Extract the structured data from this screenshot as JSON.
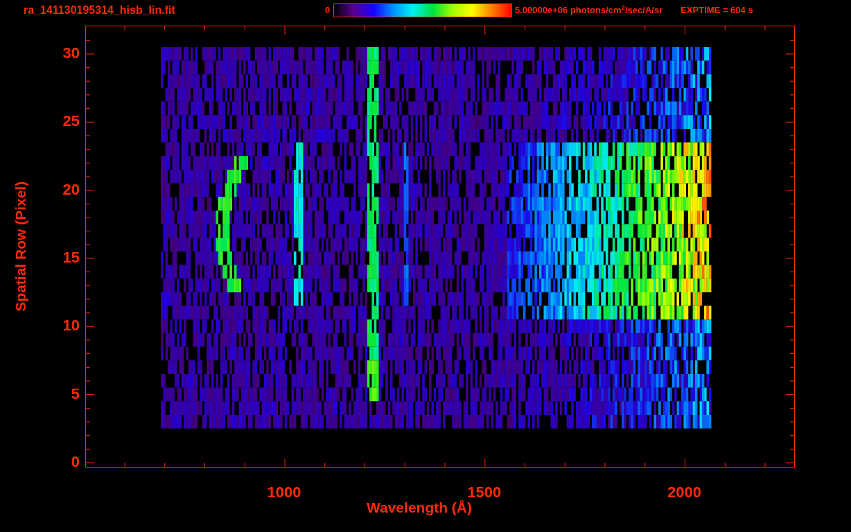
{
  "header": {
    "filename": "ra_141130195314_hisb_lin.fit",
    "colorbar_min": "0",
    "colorbar_max": "5.00000e+06 photons/cm$^{2}$/sec/A/sr",
    "exptime": "EXPTIME = 604 s"
  },
  "y_axis": {
    "title": "Spatial Row (Pixel)",
    "ticks": [
      "30",
      "25",
      "20",
      "15",
      "10",
      "5",
      "0"
    ]
  },
  "x_axis": {
    "title": "Wavelength (Å)",
    "ticks": [
      "1000",
      "1500",
      "2000"
    ]
  }
}
